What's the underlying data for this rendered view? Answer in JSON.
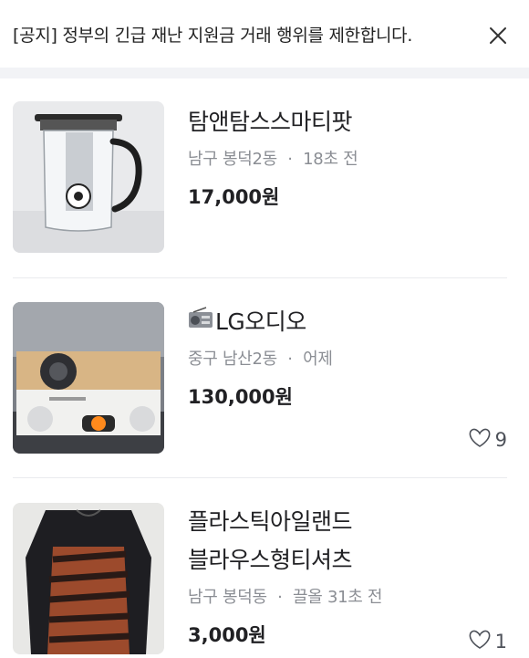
{
  "notice": {
    "text": "[공지] 정부의 긴급 재난 지원금 거래 행위를 제한합니다.",
    "close_icon": "close-icon"
  },
  "items": [
    {
      "title": "탐앤탐스스마티팟",
      "location": "남구 봉덕2동",
      "time": "18초 전",
      "price": "17,000원",
      "likes": null
    },
    {
      "title_icon": "radio-icon",
      "title": "LG오디오",
      "location": "중구 남산2동",
      "time": "어제",
      "price": "130,000원",
      "likes": "9"
    },
    {
      "title_line1": "플라스틱아일랜드",
      "title_line2": "블라우스형티셔츠",
      "location": "남구 봉덕동",
      "time": "끌올 31초 전",
      "price": "3,000원",
      "likes": "1"
    }
  ],
  "meta_separator": "·",
  "colors": {
    "text": "#212124",
    "meta": "#8b8e94",
    "divider": "#eaebee",
    "band": "#f2f3f6"
  }
}
